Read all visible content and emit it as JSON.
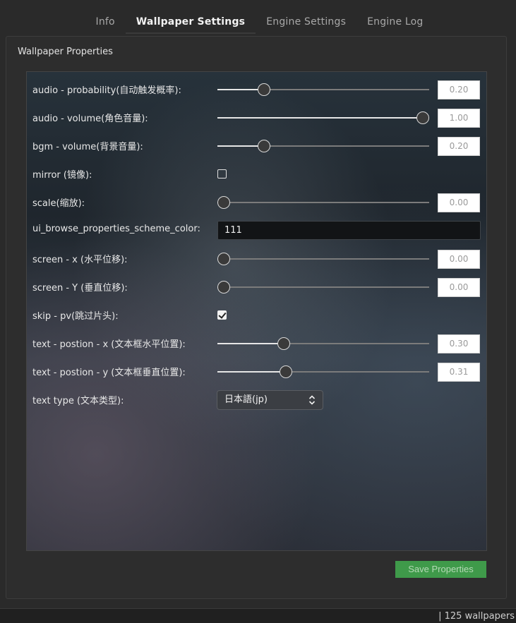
{
  "tabs": [
    {
      "label": "Info",
      "active": false
    },
    {
      "label": "Wallpaper Settings",
      "active": true
    },
    {
      "label": "Engine Settings",
      "active": false
    },
    {
      "label": "Engine Log",
      "active": false
    }
  ],
  "panel_title": "Wallpaper Properties",
  "properties": [
    {
      "label": "audio - probability(自动触发概率):",
      "type": "slider",
      "value": "0.20",
      "fraction": 0.22
    },
    {
      "label": "audio - volume(角色音量):",
      "type": "slider",
      "value": "1.00",
      "fraction": 0.97
    },
    {
      "label": "bgm - volume(背景音量):",
      "type": "slider",
      "value": "0.20",
      "fraction": 0.22
    },
    {
      "label": "mirror (镜像):",
      "type": "checkbox",
      "checked": false
    },
    {
      "label": "scale(缩放):",
      "type": "slider",
      "value": "0.00",
      "fraction": 0.03
    },
    {
      "label": "ui_browse_properties_scheme_color:",
      "type": "text",
      "value": "111"
    },
    {
      "label": "screen - x (水平位移):",
      "type": "slider",
      "value": "0.00",
      "fraction": 0.03
    },
    {
      "label": "screen - Y (垂直位移):",
      "type": "slider",
      "value": "0.00",
      "fraction": 0.03
    },
    {
      "label": "skip - pv(跳过片头):",
      "type": "checkbox",
      "checked": true
    },
    {
      "label": "text - postion - x (文本框水平位置):",
      "type": "slider",
      "value": "0.30",
      "fraction": 0.313
    },
    {
      "label": "text - postion - y (文本框垂直位置):",
      "type": "slider",
      "value": "0.31",
      "fraction": 0.323
    },
    {
      "label": "text type (文本类型):",
      "type": "select",
      "value": "日本語(jp)"
    }
  ],
  "save_label": "Save Properties",
  "status": "|  125 wallpapers",
  "colors": {
    "accent_green": "#3f9a4a",
    "background": "#2a2a2a"
  }
}
